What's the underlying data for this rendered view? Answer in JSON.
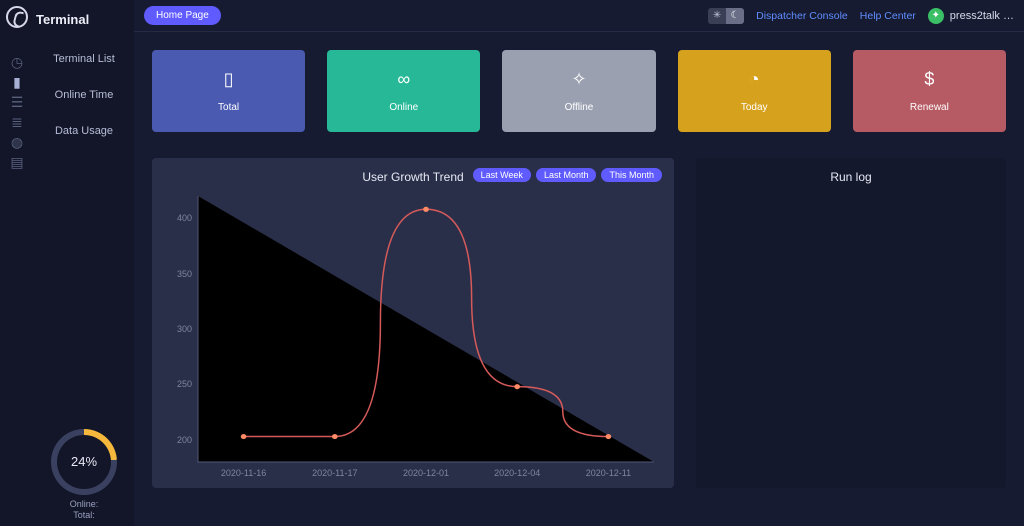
{
  "app": {
    "section": "Terminal"
  },
  "rail": {
    "items": [
      {
        "name": "dashboard-icon",
        "glyph": "◷"
      },
      {
        "name": "radio-icon",
        "glyph": "▮",
        "active": true
      },
      {
        "name": "users-icon",
        "glyph": "☰"
      },
      {
        "name": "stats-icon",
        "glyph": "≣"
      },
      {
        "name": "globe-icon",
        "glyph": "◍"
      },
      {
        "name": "doc-icon",
        "glyph": "▤"
      }
    ]
  },
  "sidebar": {
    "items": [
      {
        "label": "Terminal List"
      },
      {
        "label": "Online Time"
      },
      {
        "label": "Data Usage"
      }
    ],
    "gauge": {
      "percent": "24%",
      "caption1": "Online:",
      "caption2": "Total:"
    }
  },
  "topbar": {
    "home": "Home Page",
    "links": [
      {
        "label": "Dispatcher Console"
      },
      {
        "label": "Help Center"
      }
    ],
    "user": "press2talk  …"
  },
  "cards": [
    {
      "label": "Total",
      "color": "c-blue",
      "icon": "▯"
    },
    {
      "label": "Online",
      "color": "c-teal",
      "icon": "∞"
    },
    {
      "label": "Offline",
      "color": "c-gray",
      "icon": "✧"
    },
    {
      "label": "Today",
      "color": "c-gold",
      "icon": "◔"
    },
    {
      "label": "Renewal",
      "color": "c-rose",
      "icon": "$"
    }
  ],
  "chart_panel": {
    "title": "User Growth Trend",
    "chips": [
      "Last Week",
      "Last Month",
      "This Month"
    ]
  },
  "runlog": {
    "title": "Run log"
  },
  "chart_data": {
    "type": "line",
    "title": "User Growth Trend",
    "xlabel": "",
    "ylabel": "",
    "ylim": [
      180,
      420
    ],
    "y_ticks": [
      200,
      250,
      300,
      350,
      400
    ],
    "categories": [
      "2020-11-16",
      "2020-11-17",
      "2020-12-01",
      "2020-12-04",
      "2020-12-11"
    ],
    "values": [
      203,
      203,
      408,
      248,
      203
    ]
  }
}
